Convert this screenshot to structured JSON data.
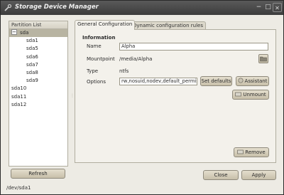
{
  "window": {
    "title": "Storage Device Manager"
  },
  "partition_list": {
    "header": "Partition List",
    "items": [
      {
        "label": "sda",
        "level": "top",
        "expander": "−",
        "selected": true
      },
      {
        "label": "sda1",
        "level": "child"
      },
      {
        "label": "sda5",
        "level": "child"
      },
      {
        "label": "sda6",
        "level": "child"
      },
      {
        "label": "sda7",
        "level": "child"
      },
      {
        "label": "sda8",
        "level": "child"
      },
      {
        "label": "sda9",
        "level": "child"
      },
      {
        "label": "sda10",
        "level": "top"
      },
      {
        "label": "sda11",
        "level": "top"
      },
      {
        "label": "sda12",
        "level": "top"
      }
    ],
    "refresh_label": "Refresh"
  },
  "tabs": [
    {
      "label": "General Configuration",
      "active": true
    },
    {
      "label": "Dynamic configuration rules",
      "active": false
    }
  ],
  "general": {
    "section_title": "Information",
    "name_label": "Name",
    "name_value": "Alpha",
    "mountpoint_label": "Mountpoint",
    "mountpoint_value": "/media/Alpha",
    "type_label": "Type",
    "type_value": "ntfs",
    "options_label": "Options",
    "options_value": "rw,nosuid,nodev,default_permiss",
    "set_defaults_label": "Set defaults",
    "assistant_label": "Assistant",
    "unmount_label": "Unmount",
    "remove_label": "Remove"
  },
  "footer": {
    "close_label": "Close",
    "apply_label": "Apply"
  },
  "status": {
    "text": "/dev/sda1"
  },
  "colors": {
    "window_bg": "#edebe4",
    "titlebar": "#474747",
    "selection": "#b8b4a2",
    "button": "#d5cebb"
  }
}
